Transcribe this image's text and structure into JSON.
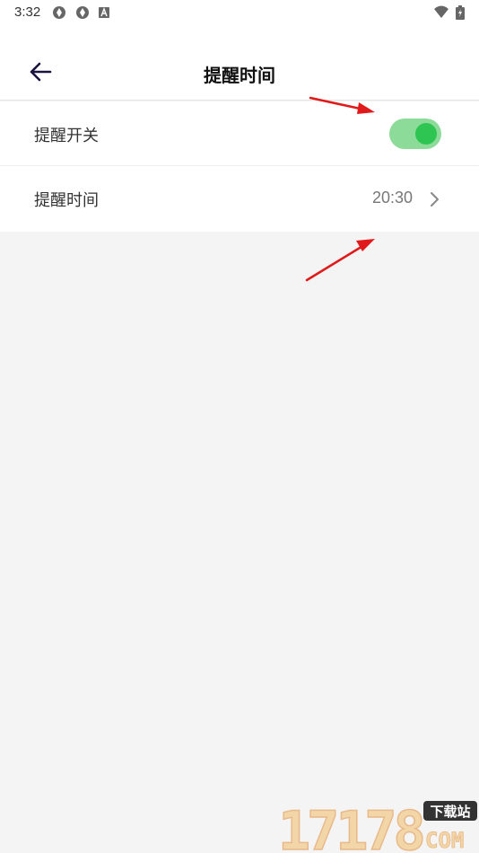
{
  "status_bar": {
    "time": "3:32",
    "left_icons": [
      "aperture-icon",
      "aperture-icon",
      "letter-a-icon"
    ],
    "right_icons": [
      "wifi-icon",
      "battery-icon"
    ]
  },
  "header": {
    "title": "提醒时间",
    "back_icon": "arrow-left-icon"
  },
  "settings": [
    {
      "label": "提醒开关",
      "control": "toggle",
      "toggle_on": true
    },
    {
      "label": "提醒时间",
      "value": "20:30",
      "control": "chevron-right-icon"
    }
  ],
  "annotations": {
    "arrow_color": "#e01a1a",
    "count": 2
  },
  "watermark": {
    "number": "17178",
    "tag": "下载站",
    "domain": "COM"
  },
  "colors": {
    "toggle_track": "#8ddb98",
    "toggle_knob": "#2fc553",
    "page_background": "#f4f4f4"
  }
}
